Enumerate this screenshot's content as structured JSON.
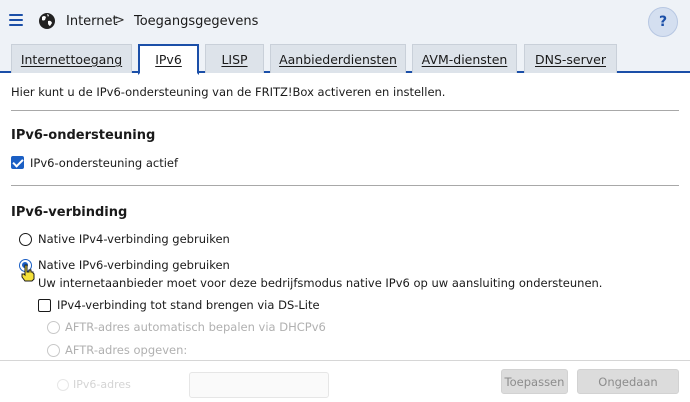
{
  "header": {
    "menu_icon": "hamburger-menu-icon",
    "globe_icon": "globe-icon",
    "breadcrumb": [
      "Internet",
      "Toegangsgegevens"
    ],
    "separator": ">",
    "help_label": "?",
    "accent_color": "#1b4fa8"
  },
  "tabs": [
    {
      "label": "Internettoegang",
      "active": false
    },
    {
      "label": "IPv6",
      "active": true
    },
    {
      "label": "LISP",
      "active": false
    },
    {
      "label": "Aanbiederdiensten",
      "active": false
    },
    {
      "label": "AVM-diensten",
      "active": false
    },
    {
      "label": "DNS-server",
      "active": false
    }
  ],
  "main": {
    "intro": "Hier kunt u de IPv6-ondersteuning van de FRITZ!Box activeren en instellen.",
    "support": {
      "title": "IPv6-ondersteuning",
      "checkbox_label": "IPv6-ondersteuning actief",
      "checked": true
    },
    "connection": {
      "title": "IPv6-verbinding",
      "options": [
        {
          "label": "Native IPv4-verbinding gebruiken",
          "checked": false
        },
        {
          "label": "Native IPv6-verbinding gebruiken",
          "checked": true
        }
      ],
      "note": "Uw internetaanbieder moet voor deze bedrijfsmodus native IPv6 op uw aansluiting ondersteunen.",
      "dslite": {
        "label": "IPv4-verbinding tot stand brengen via DS-Lite",
        "checked": false,
        "sub_options": [
          {
            "label": "AFTR-adres automatisch bepalen via DHCPv6",
            "enabled": false
          },
          {
            "label": "AFTR-adres opgeven:",
            "enabled": false
          }
        ]
      }
    }
  },
  "footer": {
    "ghost_label": "IPv6-adres",
    "apply_label": "Toepassen",
    "undo_label": "Ongedaan maken"
  }
}
